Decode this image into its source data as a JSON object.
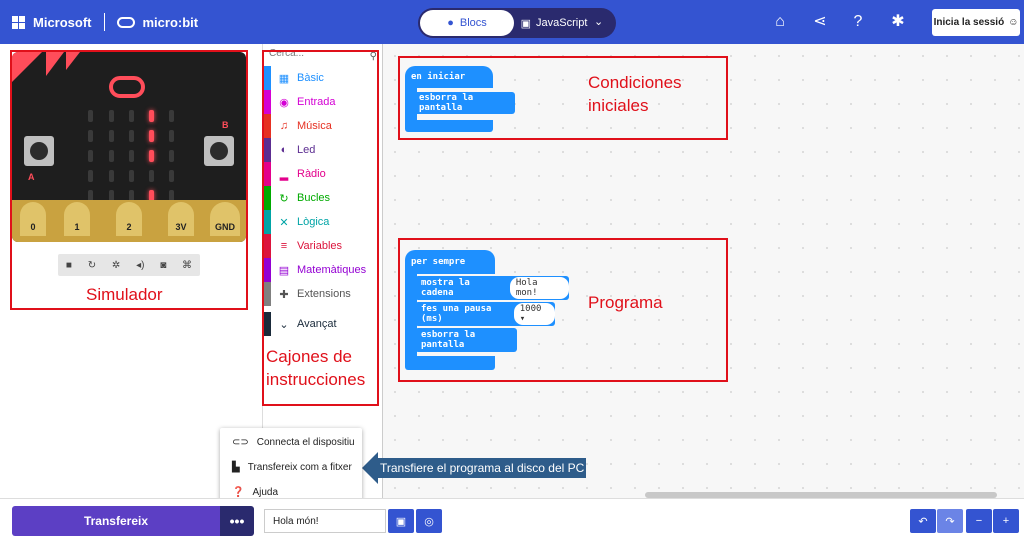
{
  "header": {
    "brand": "Microsoft",
    "product": "micro:bit",
    "mode_blocks": "Blocs",
    "mode_js": "JavaScript",
    "signin_label": "Inicia la sessió",
    "icons": [
      "home-icon",
      "share-icon",
      "help-icon",
      "settings-icon"
    ]
  },
  "simulator": {
    "pins": [
      "0",
      "1",
      "2",
      "3V",
      "GND"
    ],
    "button_a": "A",
    "button_b": "B",
    "toolbar_icons": [
      "stop-icon",
      "restart-icon",
      "debug-icon",
      "sound-icon",
      "screenshot-icon",
      "fullscreen-icon"
    ]
  },
  "toolbox": {
    "search_placeholder": "Cerca...",
    "categories": [
      {
        "label": "Bàsic",
        "color": "#1e90ff",
        "icon": "▦"
      },
      {
        "label": "Entrada",
        "color": "#d400d4",
        "icon": "◉"
      },
      {
        "label": "Música",
        "color": "#e63022",
        "icon": "♫"
      },
      {
        "label": "Led",
        "color": "#5c2d91",
        "icon": "◐"
      },
      {
        "label": "Ràdio",
        "color": "#e3008c",
        "icon": "▂"
      },
      {
        "label": "Bucles",
        "color": "#00aa00",
        "icon": "↻"
      },
      {
        "label": "Lògica",
        "color": "#00a4a6",
        "icon": "✕"
      },
      {
        "label": "Variables",
        "color": "#dc143c",
        "icon": "≡"
      },
      {
        "label": "Matemàtiques",
        "color": "#9400d3",
        "icon": "▤"
      },
      {
        "label": "Extensions",
        "color": "#808080",
        "icon": "✚"
      },
      {
        "label": "Avançat",
        "color": "#1a2a3a",
        "icon": "⌄"
      }
    ]
  },
  "workspace": {
    "on_start": "en iniciar",
    "clear_screen_1": "esborra la pantalla",
    "forever": "per sempre",
    "show_string": "mostra la cadena",
    "show_string_value": "Hola mon!",
    "pause": "fes una pausa (ms)",
    "pause_value": "1000 ▾",
    "clear_screen_2": "esborra la pantalla"
  },
  "annotations": {
    "simulator": "Simulador",
    "drawers": "Cajones de instrucciones",
    "initial": "Condiciones iniciales",
    "program": "Programa",
    "callout": "Transfiere el programa al disco del PC"
  },
  "menu": {
    "connect": "Connecta el dispositiu",
    "download_file": "Transfereix com a fitxer",
    "help": "Ajuda"
  },
  "footer": {
    "download_label": "Transfereix",
    "more_label": "•••",
    "project_name": "Hola món!"
  },
  "colors": {
    "header": "#3454d1",
    "download": "#5c3fc4",
    "block": "#1e90ff",
    "annotation": "#e0101a"
  }
}
